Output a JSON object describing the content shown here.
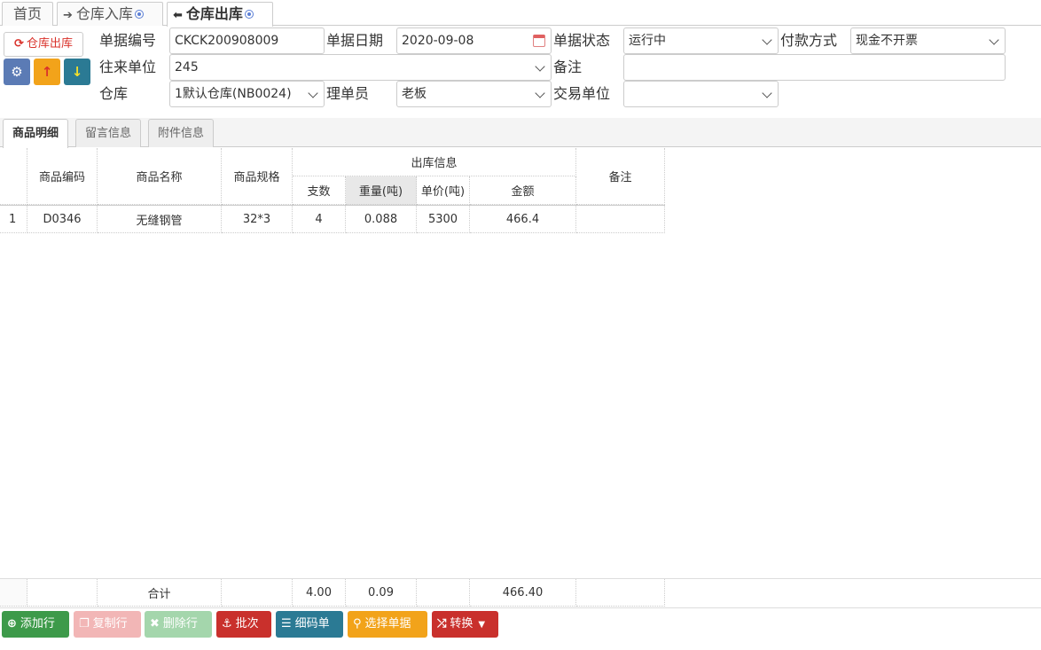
{
  "tabs": [
    {
      "label": "首页"
    },
    {
      "arrow": "➔",
      "label": "仓库入库"
    },
    {
      "arrow": "⬅",
      "label": "仓库出库"
    }
  ],
  "actions": {
    "refresh_label": "仓库出库"
  },
  "form": {
    "doc_no_label": "单据编号",
    "doc_no": "CKCK200908009",
    "doc_date_label": "单据日期",
    "doc_date": "2020-09-08",
    "doc_status_label": "单据状态",
    "doc_status": "运行中",
    "payment_label": "付款方式",
    "payment": "现金不开票",
    "partner_label": "往来单位",
    "partner": "245",
    "remark_label": "备注",
    "remark": "",
    "warehouse_label": "仓库",
    "warehouse": "1默认仓库(NB0024)",
    "handler_label": "理单员",
    "handler": "老板",
    "trade_unit_label": "交易单位",
    "trade_unit": ""
  },
  "subtabs": [
    "商品明细",
    "留言信息",
    "附件信息"
  ],
  "grid": {
    "headers": {
      "code": "商品编码",
      "name": "商品名称",
      "spec": "商品规格",
      "group": "出库信息",
      "qty": "支数",
      "weight": "重量(吨)",
      "price": "单价(吨)",
      "amount": "金额",
      "remark": "备注"
    },
    "rows": [
      {
        "no": "1",
        "code": "D0346",
        "name": "无缝钢管",
        "spec": "32*3",
        "qty": "4",
        "weight": "0.088",
        "price": "5300",
        "amount": "466.4",
        "remark": ""
      }
    ],
    "footer": {
      "label": "合计",
      "qty": "4.00",
      "weight": "0.09",
      "amount": "466.40"
    }
  },
  "toolbar": {
    "add": "添加行",
    "copy": "复制行",
    "delete": "删除行",
    "batch": "批次",
    "detail": "细码单",
    "select": "选择单据",
    "convert": "转换"
  },
  "colors": {
    "green": "#3d9a4a",
    "pink": "#f1a7a7",
    "lightgreen": "#a8d8b0",
    "red": "#c9302c",
    "teal": "#2b7a94",
    "orange": "#f2a31a",
    "blue": "#5b7bb5"
  }
}
